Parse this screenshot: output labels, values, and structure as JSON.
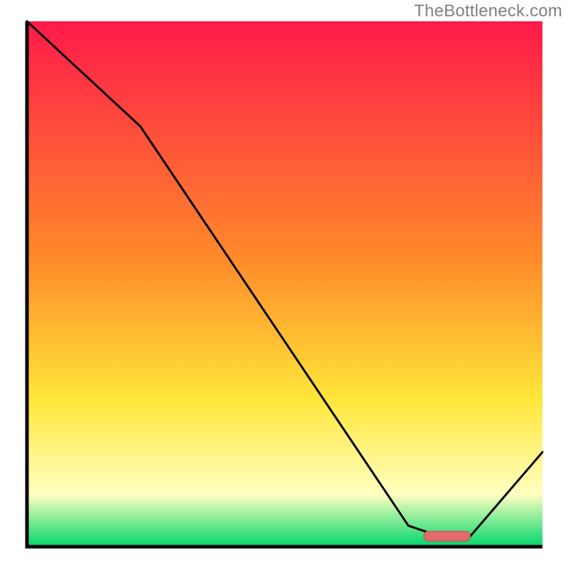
{
  "watermark": "TheBottleneck.com",
  "colors": {
    "red": "#ff1a4a",
    "orange": "#ff8a2a",
    "yellow": "#ffe63a",
    "pale": "#ffffc0",
    "green": "#00d66a",
    "border": "#000000",
    "curve": "#000000",
    "marker_fill": "#e06c6c",
    "marker_stroke": "#d04848"
  },
  "chart_data": {
    "type": "line",
    "title": "",
    "xlabel": "",
    "ylabel": "",
    "xlim": [
      0,
      100
    ],
    "ylim": [
      0,
      100
    ],
    "x": [
      0,
      22,
      74,
      80,
      86,
      100
    ],
    "values": [
      100,
      80,
      4,
      2,
      2,
      18
    ],
    "optimal_marker": {
      "x_start": 77,
      "x_end": 86,
      "y": 2
    },
    "note": "Values are approximate readings of the black curve height as a percentage of the inner plot height; x is percentage across the inner plot width. Gradient background runs red→orange→yellow→pale-yellow→green top-to-bottom."
  }
}
